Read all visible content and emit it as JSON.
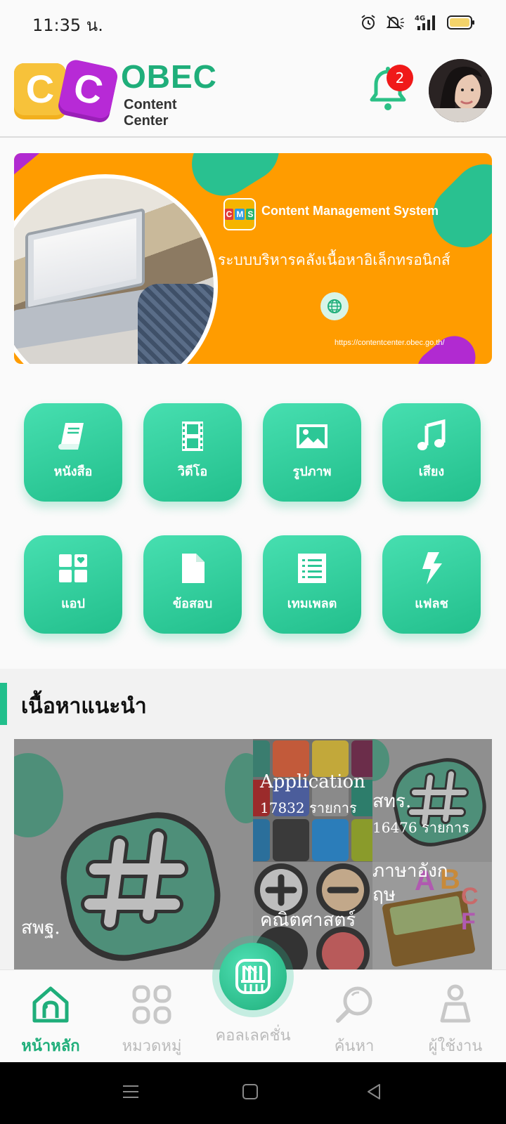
{
  "status_bar": {
    "time": "11:35 น.",
    "network": "4G"
  },
  "header": {
    "logo_letters": "CC",
    "logo_word": "OBEC",
    "logo_sub": "Content Center",
    "notification_count": "2"
  },
  "banner": {
    "cms_badge": "CMS",
    "title": "Content Management System",
    "subtitle_thai": "ระบบบริหารคลังเนื้อหาอิเล็กทรอนิกส์",
    "url": "https://contentcenter.obec.go.th/"
  },
  "categories": [
    {
      "label": "หนังสือ",
      "icon": "book-icon"
    },
    {
      "label": "วิดีโอ",
      "icon": "film-icon"
    },
    {
      "label": "รูปภาพ",
      "icon": "image-icon"
    },
    {
      "label": "เสียง",
      "icon": "music-icon"
    },
    {
      "label": "แอป",
      "icon": "apps-icon"
    },
    {
      "label": "ข้อสอบ",
      "icon": "document-icon"
    },
    {
      "label": "เทมเพลต",
      "icon": "list-icon"
    },
    {
      "label": "แฟลช",
      "icon": "flash-icon"
    }
  ],
  "recommended": {
    "title": "เนื้อหาแนะนำ",
    "cards": [
      {
        "name": "สพฐ.",
        "count": ""
      },
      {
        "name": "Application",
        "count": "17832 รายการ"
      },
      {
        "name": "สทร.",
        "count": "16476 รายการ"
      },
      {
        "name": "คณิตศาสตร์",
        "count": ""
      },
      {
        "name": "ภาษาอังกฤษ",
        "count": ""
      }
    ]
  },
  "bottom_nav": {
    "items": [
      {
        "label": "หน้าหลัก",
        "active": true
      },
      {
        "label": "หมวดหมู่",
        "active": false
      },
      {
        "label": "คอลเลคชั่น",
        "active": false
      },
      {
        "label": "ค้นหา",
        "active": false
      },
      {
        "label": "ผู้ใช้งาน",
        "active": false
      }
    ]
  },
  "colors": {
    "accent": "#1fae7a",
    "banner": "#ff9c00",
    "badge": "#f01919"
  }
}
